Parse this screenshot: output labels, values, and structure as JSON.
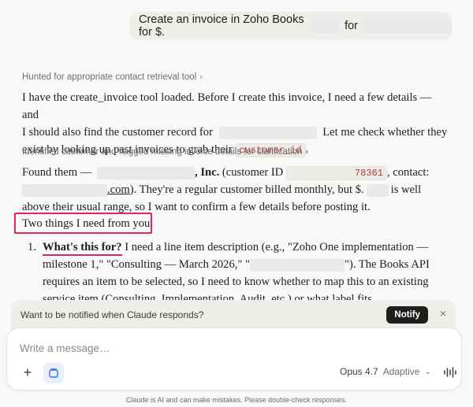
{
  "user_message": {
    "prefix": "Create an invoice in Zoho Books for $.",
    "middle": "for"
  },
  "thoughts": [
    {
      "label": "Hunted for appropriate contact retrieval tool"
    },
    {
      "label": "Identified customer and flagged missing invoice details for clarification"
    }
  ],
  "paragraph1": {
    "line1": "I have the create_invoice tool loaded. Before I create this invoice, I need a few details — and",
    "line2_prefix": "I should also find the customer record for",
    "line2_suffix": "Let me check whether they",
    "line3_prefix": "exist by looking up past invoices to grab their",
    "code": "customer_id",
    "line3_suffix": "."
  },
  "paragraph2": {
    "line1_prefix": "Found them —",
    "company_suffix": ", Inc.",
    "customer_id_label": "(customer ID",
    "customer_id_tail": "78361",
    "contact_label": ", contact:",
    "email_suffix": ".com",
    "line2_rest": "). They're a regular customer billed monthly, but $.",
    "line2_tail": "is well",
    "line3": "above their usual range, so I want to confirm a few details before posting it."
  },
  "two_things": "Two things I need from you:",
  "list": {
    "number": "1.",
    "heading": "What's this for?",
    "line1_rest": "I need a line item description (e.g., \"Zoho One implementation —",
    "line2_prefix": "milestone 1,\" \"Consulting — March 2026,\" \"",
    "line2_suffix": "\"). The Books API",
    "line3": "requires an item to be selected, so I need to know whether to map this to an existing",
    "line4": "service item (Consulting, Implementation, Audit, etc.) or what label fits."
  },
  "notify": {
    "text": "Want to be notified when Claude responds?",
    "button": "Notify",
    "close": "×"
  },
  "composer": {
    "placeholder": "Write a message…",
    "plus": "+",
    "model": "Opus 4.7",
    "mode": "Adaptive",
    "chevron": "⌄"
  },
  "footer": "Claude is AI and can make mistakes. Please double-check responses.",
  "colors": {
    "accent_highlight": "#e0245e",
    "code_text": "#b23c3c",
    "notify_button": "#1f1e1d"
  }
}
